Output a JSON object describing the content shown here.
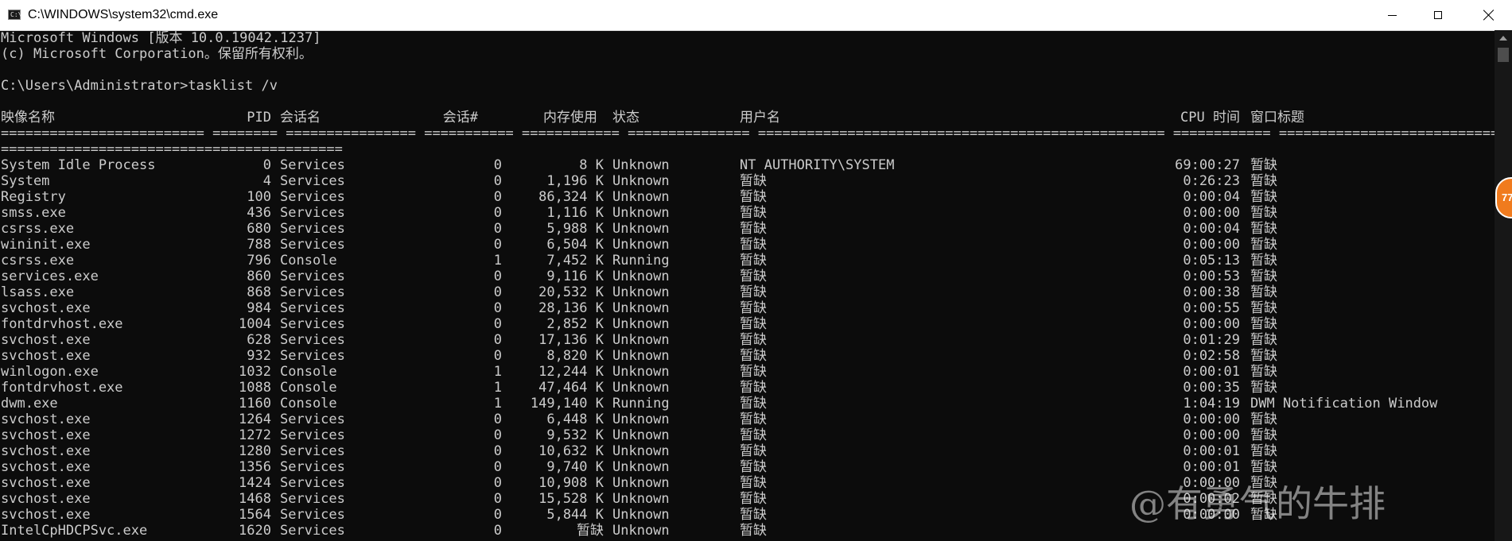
{
  "window": {
    "title": "C:\\WINDOWS\\system32\\cmd.exe"
  },
  "console": {
    "banner_line1": "Microsoft Windows [版本 10.0.19042.1237]",
    "banner_line2": "(c) Microsoft Corporation。保留所有权利。",
    "prompt": "C:\\Users\\Administrator>tasklist /v",
    "headers": [
      "映像名称",
      "PID",
      "会话名",
      "会话#",
      "内存使用",
      "状态",
      "用户名",
      "CPU 时间",
      "窗口标题"
    ],
    "separator1": "========================= ======== ================ =========== ============ =============== ================================================== ============ ========================================================================",
    "separator2": "==========================================",
    "rows": [
      {
        "image": "System Idle Process",
        "pid": "0",
        "session": "Services",
        "session_num": "0",
        "mem": "8 K",
        "status": "Unknown",
        "user": "NT AUTHORITY\\SYSTEM",
        "cpu": "69:00:27",
        "title": "暂缺"
      },
      {
        "image": "System",
        "pid": "4",
        "session": "Services",
        "session_num": "0",
        "mem": "1,196 K",
        "status": "Unknown",
        "user": "暂缺",
        "cpu": "0:26:23",
        "title": "暂缺"
      },
      {
        "image": "Registry",
        "pid": "100",
        "session": "Services",
        "session_num": "0",
        "mem": "86,324 K",
        "status": "Unknown",
        "user": "暂缺",
        "cpu": "0:00:04",
        "title": "暂缺"
      },
      {
        "image": "smss.exe",
        "pid": "436",
        "session": "Services",
        "session_num": "0",
        "mem": "1,116 K",
        "status": "Unknown",
        "user": "暂缺",
        "cpu": "0:00:00",
        "title": "暂缺"
      },
      {
        "image": "csrss.exe",
        "pid": "680",
        "session": "Services",
        "session_num": "0",
        "mem": "5,988 K",
        "status": "Unknown",
        "user": "暂缺",
        "cpu": "0:00:04",
        "title": "暂缺"
      },
      {
        "image": "wininit.exe",
        "pid": "788",
        "session": "Services",
        "session_num": "0",
        "mem": "6,504 K",
        "status": "Unknown",
        "user": "暂缺",
        "cpu": "0:00:00",
        "title": "暂缺"
      },
      {
        "image": "csrss.exe",
        "pid": "796",
        "session": "Console",
        "session_num": "1",
        "mem": "7,452 K",
        "status": "Running",
        "user": "暂缺",
        "cpu": "0:05:13",
        "title": "暂缺"
      },
      {
        "image": "services.exe",
        "pid": "860",
        "session": "Services",
        "session_num": "0",
        "mem": "9,116 K",
        "status": "Unknown",
        "user": "暂缺",
        "cpu": "0:00:53",
        "title": "暂缺"
      },
      {
        "image": "lsass.exe",
        "pid": "868",
        "session": "Services",
        "session_num": "0",
        "mem": "20,532 K",
        "status": "Unknown",
        "user": "暂缺",
        "cpu": "0:00:38",
        "title": "暂缺"
      },
      {
        "image": "svchost.exe",
        "pid": "984",
        "session": "Services",
        "session_num": "0",
        "mem": "28,136 K",
        "status": "Unknown",
        "user": "暂缺",
        "cpu": "0:00:55",
        "title": "暂缺"
      },
      {
        "image": "fontdrvhost.exe",
        "pid": "1004",
        "session": "Services",
        "session_num": "0",
        "mem": "2,852 K",
        "status": "Unknown",
        "user": "暂缺",
        "cpu": "0:00:00",
        "title": "暂缺"
      },
      {
        "image": "svchost.exe",
        "pid": "628",
        "session": "Services",
        "session_num": "0",
        "mem": "17,136 K",
        "status": "Unknown",
        "user": "暂缺",
        "cpu": "0:01:29",
        "title": "暂缺"
      },
      {
        "image": "svchost.exe",
        "pid": "932",
        "session": "Services",
        "session_num": "0",
        "mem": "8,820 K",
        "status": "Unknown",
        "user": "暂缺",
        "cpu": "0:02:58",
        "title": "暂缺"
      },
      {
        "image": "winlogon.exe",
        "pid": "1032",
        "session": "Console",
        "session_num": "1",
        "mem": "12,244 K",
        "status": "Unknown",
        "user": "暂缺",
        "cpu": "0:00:01",
        "title": "暂缺"
      },
      {
        "image": "fontdrvhost.exe",
        "pid": "1088",
        "session": "Console",
        "session_num": "1",
        "mem": "47,464 K",
        "status": "Unknown",
        "user": "暂缺",
        "cpu": "0:00:35",
        "title": "暂缺"
      },
      {
        "image": "dwm.exe",
        "pid": "1160",
        "session": "Console",
        "session_num": "1",
        "mem": "149,140 K",
        "status": "Running",
        "user": "暂缺",
        "cpu": "1:04:19",
        "title": "DWM Notification Window"
      },
      {
        "image": "svchost.exe",
        "pid": "1264",
        "session": "Services",
        "session_num": "0",
        "mem": "6,448 K",
        "status": "Unknown",
        "user": "暂缺",
        "cpu": "0:00:00",
        "title": "暂缺"
      },
      {
        "image": "svchost.exe",
        "pid": "1272",
        "session": "Services",
        "session_num": "0",
        "mem": "9,532 K",
        "status": "Unknown",
        "user": "暂缺",
        "cpu": "0:00:00",
        "title": "暂缺"
      },
      {
        "image": "svchost.exe",
        "pid": "1280",
        "session": "Services",
        "session_num": "0",
        "mem": "10,632 K",
        "status": "Unknown",
        "user": "暂缺",
        "cpu": "0:00:01",
        "title": "暂缺"
      },
      {
        "image": "svchost.exe",
        "pid": "1356",
        "session": "Services",
        "session_num": "0",
        "mem": "9,740 K",
        "status": "Unknown",
        "user": "暂缺",
        "cpu": "0:00:01",
        "title": "暂缺"
      },
      {
        "image": "svchost.exe",
        "pid": "1424",
        "session": "Services",
        "session_num": "0",
        "mem": "10,908 K",
        "status": "Unknown",
        "user": "暂缺",
        "cpu": "0:00:00",
        "title": "暂缺"
      },
      {
        "image": "svchost.exe",
        "pid": "1468",
        "session": "Services",
        "session_num": "0",
        "mem": "15,528 K",
        "status": "Unknown",
        "user": "暂缺",
        "cpu": "0:00:02",
        "title": "暂缺"
      },
      {
        "image": "svchost.exe",
        "pid": "1564",
        "session": "Services",
        "session_num": "0",
        "mem": "5,844 K",
        "status": "Unknown",
        "user": "暂缺",
        "cpu": "0:00:00",
        "title": "暂缺"
      },
      {
        "image": "IntelCpHDCPSvc.exe",
        "pid": "1620",
        "session": "Services",
        "session_num": "0",
        "mem": "暂缺",
        "status": "Unknown",
        "user": "暂缺",
        "cpu": "",
        "title": ""
      }
    ]
  },
  "badge": {
    "text": "77"
  },
  "watermark": {
    "text": "@有勇气的牛排"
  },
  "colors": {
    "console_bg": "#0c0c0c",
    "console_text": "#cccccc",
    "badge": "#f07b1e"
  },
  "icons": {
    "app": "cmd-icon",
    "minimize": "minimize-icon",
    "maximize": "maximize-icon",
    "close": "close-icon"
  }
}
